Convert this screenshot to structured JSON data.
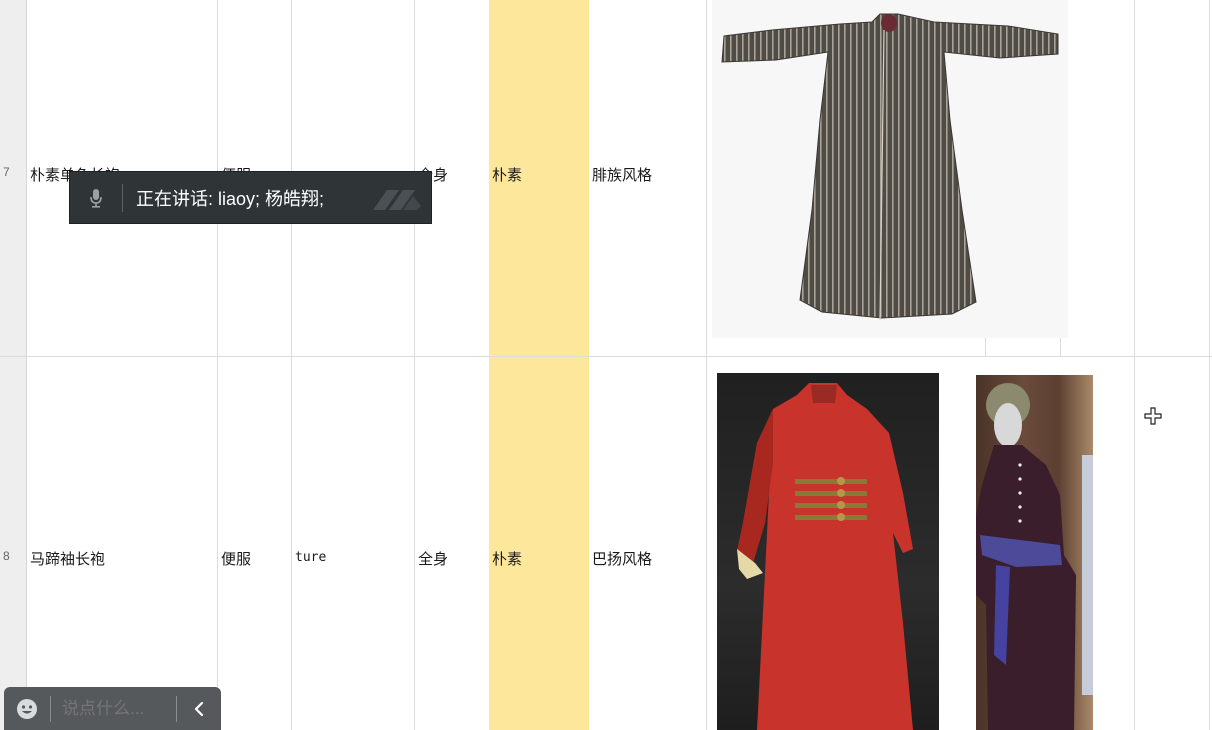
{
  "rows": [
    {
      "number": "7",
      "name": "朴素单色长袍",
      "type": "便服",
      "flag": "",
      "part": "全身",
      "style": "朴素",
      "culture": "腓族风格"
    },
    {
      "number": "8",
      "name": "马蹄袖长袍",
      "type": "便服",
      "flag": "ture",
      "part": "全身",
      "style": "朴素",
      "culture": "巴扬风格"
    }
  ],
  "speaking_overlay": {
    "text": "正在讲话:   liaoy; 杨皓翔;",
    "icon": "microphone-icon"
  },
  "chat_input": {
    "placeholder": "说点什么...",
    "emoji_icon": "emoji-icon",
    "collapse_icon": "chevron-left-icon"
  },
  "colors": {
    "highlight_column": "#fde79a",
    "overlay_bg": "#2f3437",
    "chatbar_bg": "#55595c"
  }
}
